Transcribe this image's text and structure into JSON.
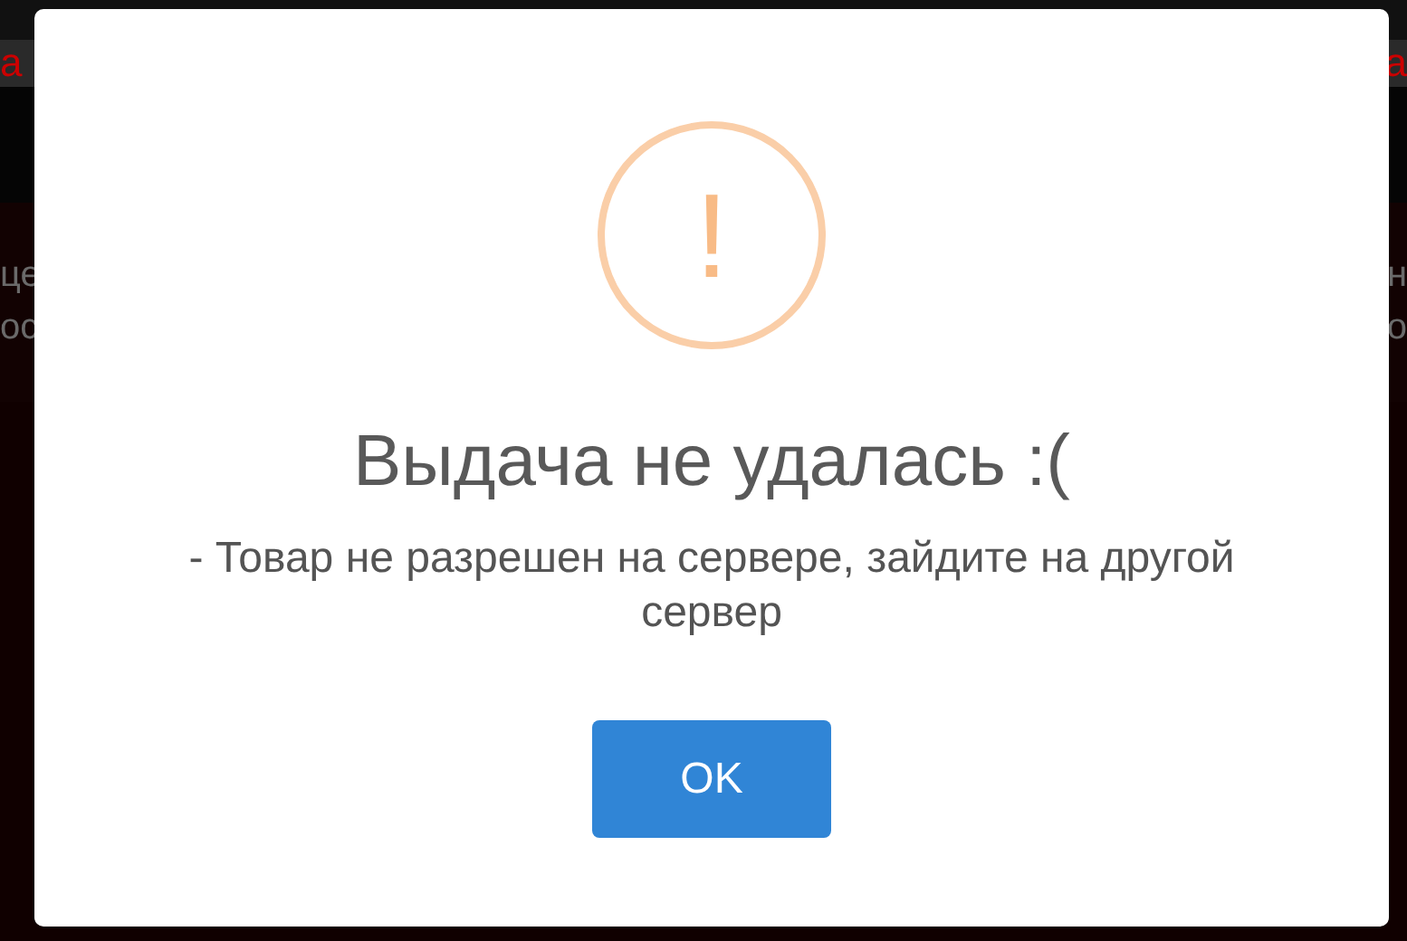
{
  "background": {
    "header_left": "а",
    "header_right": "а",
    "line_1_left": "це",
    "line_1_right": "н",
    "line_2_left": "ос",
    "line_2_right": "о"
  },
  "dialog": {
    "icon": "!",
    "title": "Выдача не удалась :(",
    "message": "- Товар не разрешен на сервере, зайдите на другой сервер",
    "buttons": [
      {
        "label": "OK"
      }
    ]
  }
}
